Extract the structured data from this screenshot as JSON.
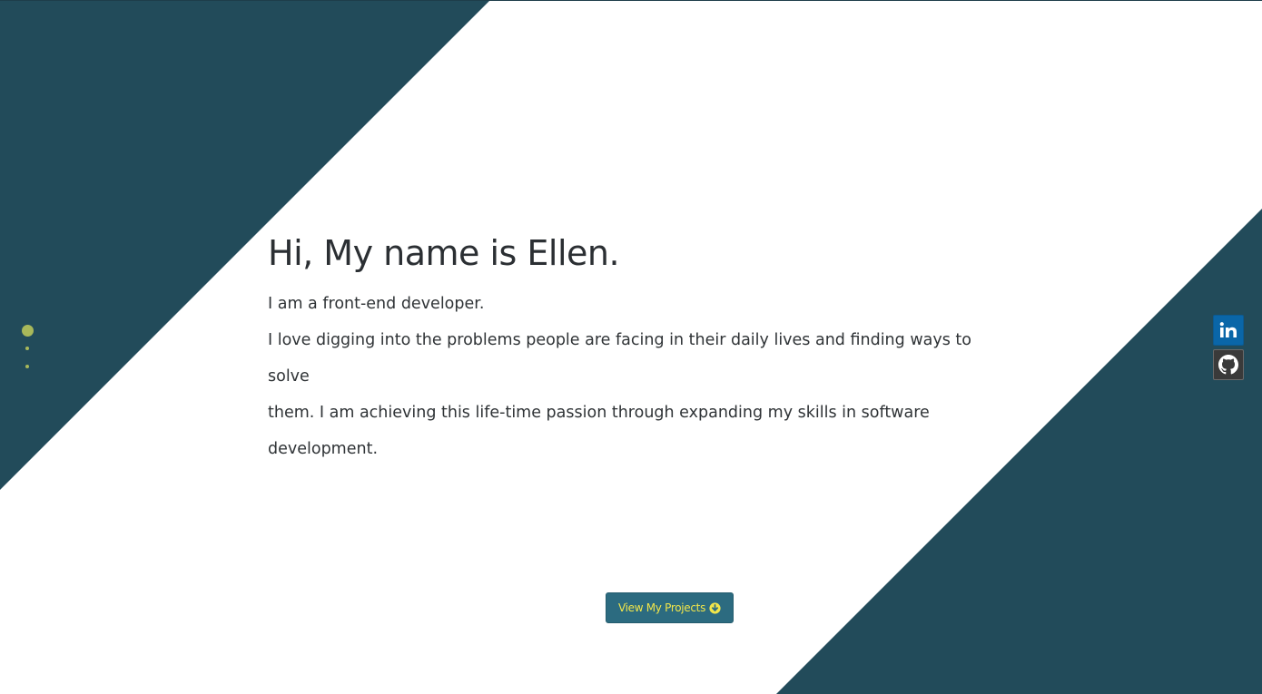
{
  "hero": {
    "heading": "Hi, My name is Ellen.",
    "intro": "I am a front-end developer.",
    "bio_line1": "I love digging into the problems people are facing in their daily lives and finding ways to solve",
    "bio_line2": "them. I am achieving this life-time passion through expanding my skills in software development."
  },
  "cta": {
    "label": "View My Projects",
    "icon": "arrow-circle-down-icon"
  },
  "social": [
    {
      "name": "linkedin",
      "icon": "linkedin-icon",
      "color": "#0a66a8"
    },
    {
      "name": "github",
      "icon": "github-icon",
      "color": "#3a3a3a"
    }
  ],
  "nav_dots": {
    "count": 3,
    "active_index": 0,
    "color": "#a8b85a"
  },
  "colors": {
    "background": "#ffffff",
    "diagonal": "#224b5a",
    "accent_text": "#f2e64a",
    "button": "#2c6b80"
  }
}
